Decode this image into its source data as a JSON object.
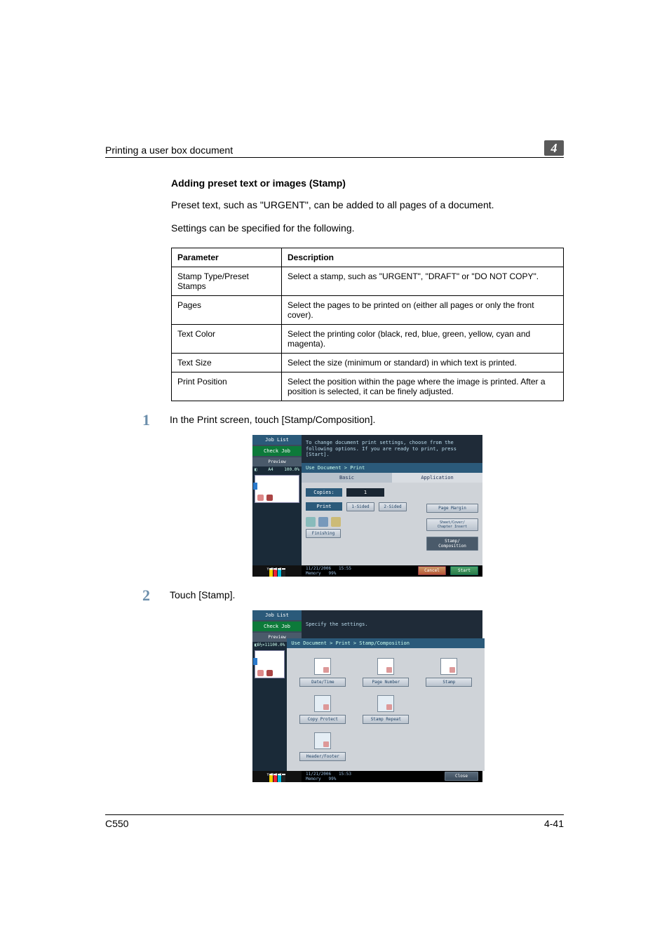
{
  "header": {
    "breadcrumb": "Printing a user box document",
    "chapter_number": "4"
  },
  "section": {
    "title": "Adding preset text or images (Stamp)",
    "intro1": "Preset text, such as \"URGENT\", can be added to all pages of a document.",
    "intro2": "Settings can be specified for the following."
  },
  "table": {
    "head": {
      "c1": "Parameter",
      "c2": "Description"
    },
    "rows": [
      {
        "c1": "Stamp Type/Preset Stamps",
        "c2": "Select a stamp, such as \"URGENT\", \"DRAFT\" or \"DO NOT COPY\"."
      },
      {
        "c1": "Pages",
        "c2": "Select the pages to be printed on (either all pages or only the front cover)."
      },
      {
        "c1": "Text Color",
        "c2": "Select the printing color (black, red, blue, green, yellow, cyan and magenta)."
      },
      {
        "c1": "Text Size",
        "c2": "Select the size (minimum or standard) in which text is printed."
      },
      {
        "c1": "Print Position",
        "c2": "Select the position within the page where the image is printed. After a position is selected, it can be finely adjusted."
      }
    ]
  },
  "steps": {
    "s1": {
      "num": "1",
      "text": "In the Print screen, touch [Stamp/Composition]."
    },
    "s2": {
      "num": "2",
      "text": "Touch [Stamp]."
    }
  },
  "screen1": {
    "joblist": "Job List",
    "checkjob": "Check Job",
    "preview": "Preview",
    "thumb_info_left": "A4",
    "thumb_info_right": "100.0%",
    "message": "To change document print settings, choose from the following options. If you are ready to print, press [Start].",
    "crumb": "Use Document > Print",
    "tab_basic": "Basic",
    "tab_app": "Application",
    "copies_label": "Copies:",
    "copies_value": "1",
    "print_label": "Print",
    "sided1": "1-Sided",
    "sided2": "2-Sided",
    "finishing": "Finishing",
    "side": {
      "margin": "Page Margin",
      "sheet": "Sheet/Cover/\nChapter Insert",
      "stamp": "Stamp/\nComposition"
    },
    "footer_date": "11/21/2006",
    "footer_time": "15:55",
    "footer_mem": "Memory",
    "footer_pct": "99%",
    "cancel": "Cancel",
    "start": "Start",
    "ink": {
      "y": "Y",
      "m": "M",
      "c": "C",
      "k": "K"
    }
  },
  "screen2": {
    "joblist": "Job List",
    "checkjob": "Check Job",
    "preview": "Preview",
    "thumb_info_left": "8½×11",
    "thumb_info_right": "100.0%",
    "message": "Specify the settings.",
    "crumb": "Use Document > Print > Stamp/Composition",
    "btns": {
      "datetime": "Date/Time",
      "pagenum": "Page Number",
      "stamp": "Stamp",
      "copyprotect": "Copy Protect",
      "stamprepeat": "Stamp Repeat",
      "headerfooter": "Header/Footer"
    },
    "footer_date": "11/21/2006",
    "footer_time": "15:53",
    "footer_mem": "Memory",
    "footer_pct": "99%",
    "close": "Close",
    "ink": {
      "y": "Y",
      "m": "M",
      "c": "C",
      "k": "K"
    }
  },
  "footer": {
    "model": "C550",
    "page": "4-41"
  }
}
